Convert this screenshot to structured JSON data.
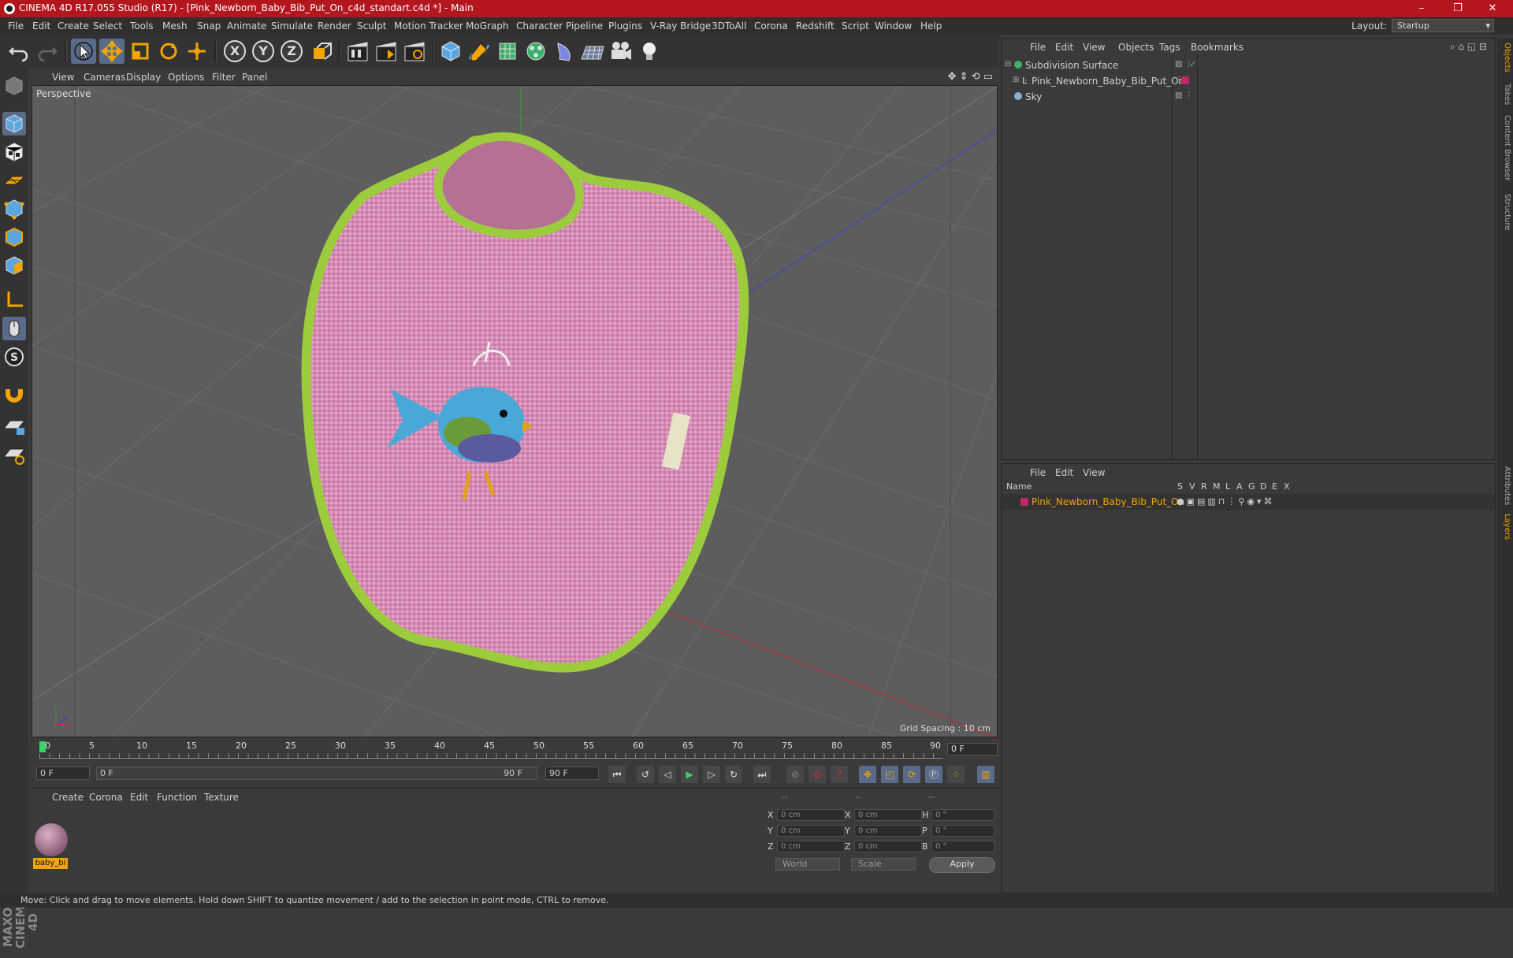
{
  "window": {
    "title": "CINEMA 4D R17.055 Studio (R17) - [Pink_Newborn_Baby_Bib_Put_On_c4d_standart.c4d *] - Main",
    "minimize": "–",
    "maximize": "❐",
    "close": "✕"
  },
  "menubar": {
    "items": [
      "File",
      "Edit",
      "Create",
      "Select",
      "Tools",
      "Mesh",
      "Snap",
      "Animate",
      "Simulate",
      "Render",
      "Sculpt",
      "Motion Tracker",
      "MoGraph",
      "Character",
      "Pipeline",
      "Plugins",
      "V-Ray Bridge",
      "3DToAll",
      "Corona",
      "Redshift",
      "Script",
      "Window",
      "Help"
    ],
    "layout_label": "Layout:",
    "layout_value": "Startup"
  },
  "toolbar": {
    "axis_x": "X",
    "axis_y": "Y",
    "axis_z": "Z"
  },
  "viewport": {
    "menu": [
      "View",
      "Cameras",
      "Display",
      "Options",
      "Filter",
      "Panel"
    ],
    "label": "Perspective",
    "grid_spacing": "Grid Spacing : 10 cm"
  },
  "timeline": {
    "ticks": [
      "0",
      "5",
      "10",
      "15",
      "20",
      "25",
      "30",
      "35",
      "40",
      "45",
      "50",
      "55",
      "60",
      "65",
      "70",
      "75",
      "80",
      "85",
      "90"
    ],
    "current_frame": "0 F",
    "start_field": "0 F",
    "range_start": "0 F",
    "range_end": "90 F",
    "end_field": "90 F"
  },
  "material_panel": {
    "menu": [
      "Create",
      "Corona",
      "Edit",
      "Function",
      "Texture"
    ],
    "materials": [
      {
        "name": "baby_bi"
      }
    ]
  },
  "coordinates": {
    "header": [
      "--",
      "--",
      "--"
    ],
    "rows": [
      {
        "l1": "X",
        "v1": "0 cm",
        "l2": "X",
        "v2": "0 cm",
        "l3": "H",
        "v3": "0 °"
      },
      {
        "l1": "Y",
        "v1": "0 cm",
        "l2": "Y",
        "v2": "0 cm",
        "l3": "P",
        "v3": "0 °"
      },
      {
        "l1": "Z",
        "v1": "0 cm",
        "l2": "Z",
        "v2": "0 cm",
        "l3": "B",
        "v3": "0 °"
      }
    ],
    "mode_world": "World",
    "mode_scale": "Scale",
    "apply": "Apply"
  },
  "object_manager": {
    "menu": [
      "File",
      "Edit",
      "View",
      "Objects",
      "Tags",
      "Bookmarks"
    ],
    "objects": [
      {
        "name": "Subdivision Surface"
      },
      {
        "name": "Pink_Newborn_Baby_Bib_Put_On"
      },
      {
        "name": "Sky"
      }
    ]
  },
  "layer_manager": {
    "menu": [
      "File",
      "Edit",
      "View"
    ],
    "col_name": "Name",
    "cols": [
      "S",
      "V",
      "R",
      "M",
      "L",
      "A",
      "G",
      "D",
      "E",
      "X"
    ],
    "layers": [
      {
        "name": "Pink_Newborn_Baby_Bib_Put_On",
        "color": "#c0266a"
      }
    ]
  },
  "right_tabs": [
    "Objects",
    "Takes",
    "Content Browser",
    "Structure",
    "Attributes",
    "Layers"
  ],
  "brand": "MAXON CINEMA 4D",
  "status": "Move: Click and drag to move elements. Hold down SHIFT to quantize movement / add to the selection in point mode, CTRL to remove.",
  "colors": {
    "title_bar": "#b4161e",
    "accent_orange": "#f2a400",
    "bib_pink": "#d98cb8",
    "bib_trim": "#9ccc3c"
  }
}
